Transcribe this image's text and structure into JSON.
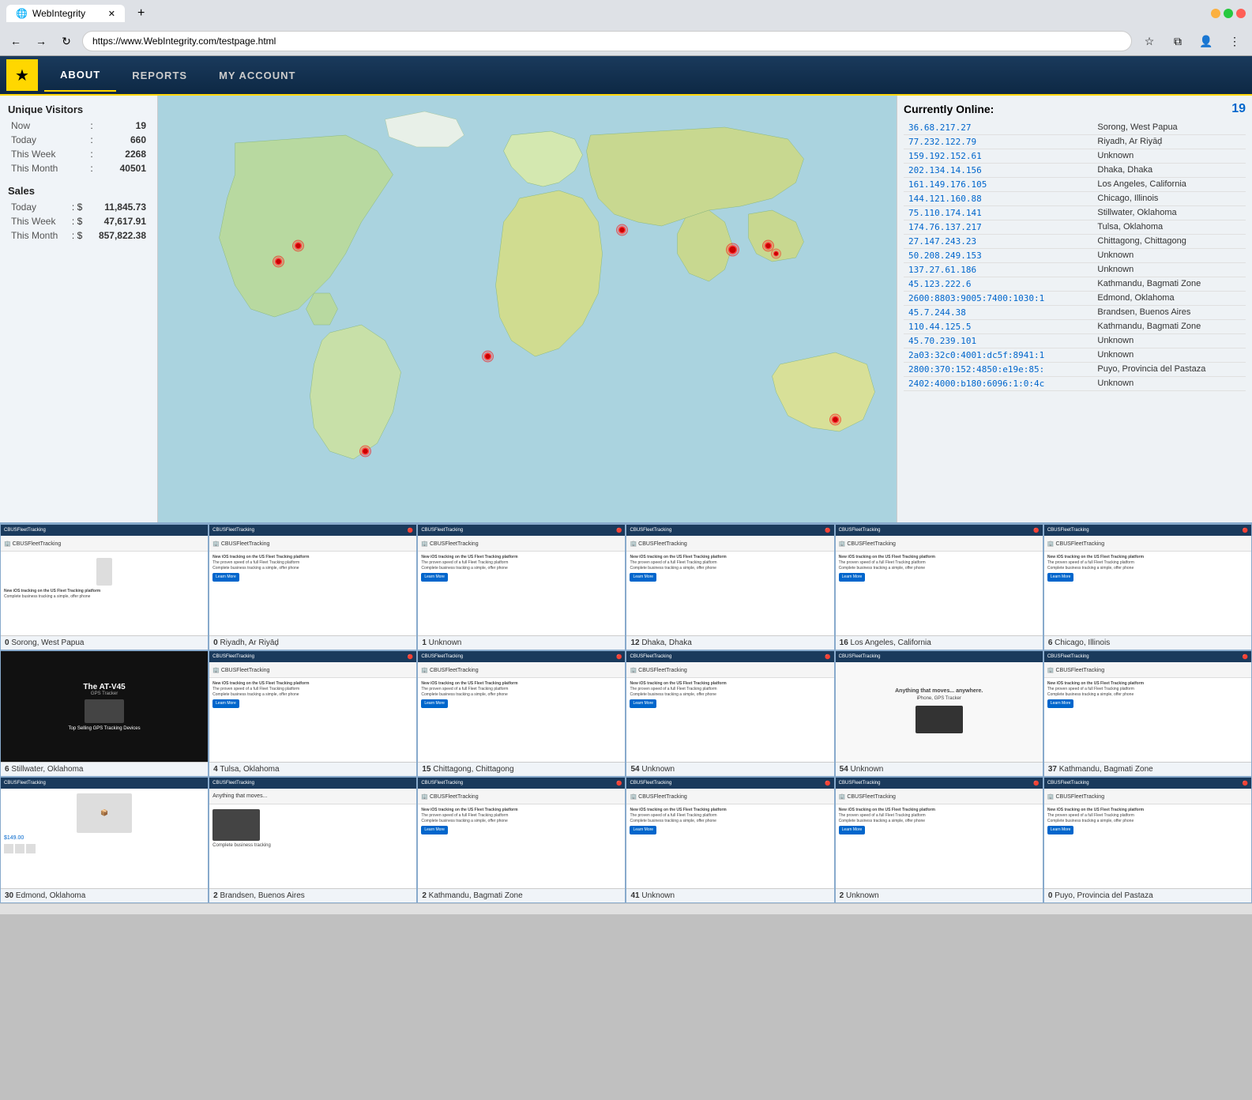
{
  "browser": {
    "tab_title": "WebIntegrity",
    "url": "https://www.WebIntegrity.com/testpage.html",
    "new_tab_label": "+",
    "back_btn": "←",
    "forward_btn": "→",
    "refresh_btn": "↻"
  },
  "nav": {
    "logo": "★",
    "items": [
      "ABOUT",
      "REPORTS",
      "MY ACCOUNT"
    ]
  },
  "unique_visitors": {
    "title": "Unique Visitors",
    "rows": [
      {
        "label": "Now",
        "sep": ":",
        "value": "19"
      },
      {
        "label": "Today",
        "sep": ":",
        "value": "660"
      },
      {
        "label": "This Week",
        "sep": ":",
        "value": "2268"
      },
      {
        "label": "This Month",
        "sep": ":",
        "value": "40501"
      }
    ]
  },
  "sales": {
    "title": "Sales",
    "rows": [
      {
        "label": "Today",
        "sep": ":  $",
        "value": "11,845.73"
      },
      {
        "label": "This Week",
        "sep": ":  $",
        "value": "47,617.91"
      },
      {
        "label": "This Month",
        "sep": ":  $",
        "value": "857,822.38"
      }
    ]
  },
  "online": {
    "title": "Currently Online:",
    "count": "19",
    "visitors": [
      {
        "ip": "36.68.217.27",
        "location": "Sorong, West Papua"
      },
      {
        "ip": "77.232.122.79",
        "location": "Riyadh, Ar Riyāḑ"
      },
      {
        "ip": "159.192.152.61",
        "location": "Unknown"
      },
      {
        "ip": "202.134.14.156",
        "location": "Dhaka, Dhaka"
      },
      {
        "ip": "161.149.176.105",
        "location": "Los Angeles, California"
      },
      {
        "ip": "144.121.160.88",
        "location": "Chicago, Illinois"
      },
      {
        "ip": "75.110.174.141",
        "location": "Stillwater, Oklahoma"
      },
      {
        "ip": "174.76.137.217",
        "location": "Tulsa, Oklahoma"
      },
      {
        "ip": "27.147.243.23",
        "location": "Chittagong, Chittagong"
      },
      {
        "ip": "50.208.249.153",
        "location": "Unknown"
      },
      {
        "ip": "137.27.61.186",
        "location": "Unknown"
      },
      {
        "ip": "45.123.222.6",
        "location": "Kathmandu, Bagmati Zone"
      },
      {
        "ip": "2600:8803:9005:7400:1030:1",
        "location": "Edmond, Oklahoma"
      },
      {
        "ip": "45.7.244.38",
        "location": "Brandsen, Buenos Aires"
      },
      {
        "ip": "110.44.125.5",
        "location": "Kathmandu, Bagmati Zone"
      },
      {
        "ip": "45.70.239.101",
        "location": "Unknown"
      },
      {
        "ip": "2a03:32c0:4001:dc5f:8941:1",
        "location": "Unknown"
      },
      {
        "ip": "2800:370:152:4850:e19e:85:",
        "location": "Puyo, Provincia del Pastaza"
      },
      {
        "ip": "2402:4000:b180:6096:1:0:4c",
        "location": "Unknown"
      }
    ]
  },
  "visitor_cells": [
    {
      "count": "0",
      "location": "Sorong, West Papua",
      "type": "mobile"
    },
    {
      "count": "0",
      "location": "Riyadh, Ar Riyāḑ",
      "type": "tracking"
    },
    {
      "count": "1",
      "location": "Unknown",
      "type": "tracking"
    },
    {
      "count": "12",
      "location": "Dhaka, Dhaka",
      "type": "tracking"
    },
    {
      "count": "16",
      "location": "Los Angeles, California",
      "type": "tracking"
    },
    {
      "count": "6",
      "location": "Chicago, Illinois",
      "type": "tracking"
    },
    {
      "count": "6",
      "location": "Stillwater, Oklahoma",
      "type": "dark"
    },
    {
      "count": "4",
      "location": "Tulsa, Oklahoma",
      "type": "tracking"
    },
    {
      "count": "15",
      "location": "Chittagong, Chittagong",
      "type": "tracking"
    },
    {
      "count": "54",
      "location": "Unknown",
      "type": "tracking"
    },
    {
      "count": "54",
      "location": "Unknown",
      "type": "dark2"
    },
    {
      "count": "37",
      "location": "Kathmandu, Bagmati Zone",
      "type": "tracking"
    },
    {
      "count": "30",
      "location": "Edmond, Oklahoma",
      "type": "product"
    },
    {
      "count": "2",
      "location": "Brandsen, Buenos Aires",
      "type": "tracking2"
    },
    {
      "count": "2",
      "location": "Kathmandu, Bagmati Zone",
      "type": "tracking"
    },
    {
      "count": "41",
      "location": "Unknown",
      "type": "tracking"
    },
    {
      "count": "2",
      "location": "Unknown",
      "type": "tracking"
    },
    {
      "count": "0",
      "location": "Puyo, Provincia del Pastaza",
      "type": "tracking"
    }
  ]
}
